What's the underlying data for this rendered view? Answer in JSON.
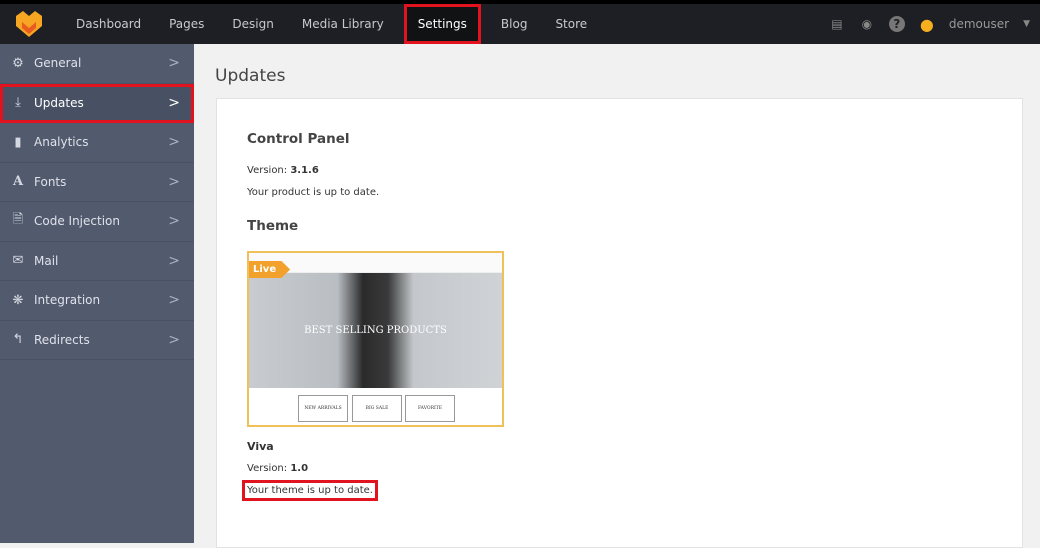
{
  "topnav": {
    "items": [
      "Dashboard",
      "Pages",
      "Design",
      "Media Library",
      "Settings",
      "Blog",
      "Store"
    ],
    "active": "Settings",
    "user": "demouser"
  },
  "sidebar": {
    "items": [
      {
        "label": "General",
        "icon": "gears-icon"
      },
      {
        "label": "Updates",
        "icon": "download-icon"
      },
      {
        "label": "Analytics",
        "icon": "bar-chart-icon"
      },
      {
        "label": "Fonts",
        "icon": "font-icon"
      },
      {
        "label": "Code Injection",
        "icon": "code-file-icon"
      },
      {
        "label": "Mail",
        "icon": "envelope-icon"
      },
      {
        "label": "Integration",
        "icon": "integration-icon"
      },
      {
        "label": "Redirects",
        "icon": "redirect-icon"
      }
    ]
  },
  "page": {
    "title": "Updates",
    "control_panel": {
      "heading": "Control Panel",
      "version_label": "Version:",
      "version": "3.1.6",
      "status": "Your product is up to date."
    },
    "theme": {
      "heading": "Theme",
      "badge": "Live",
      "hero_text": "BEST SELLING PRODUCTS",
      "buttons": [
        "NEW ARRIVALS",
        "BIG SALE",
        "FAVORITE"
      ],
      "name": "Viva",
      "version_label": "Version:",
      "version": "1.0",
      "status": "Your theme is up to date."
    }
  },
  "colors": {
    "accent": "#f2a12c",
    "highlight": "#e0131e",
    "sidebar": "#525a6e",
    "topbar": "#1e1f24"
  }
}
